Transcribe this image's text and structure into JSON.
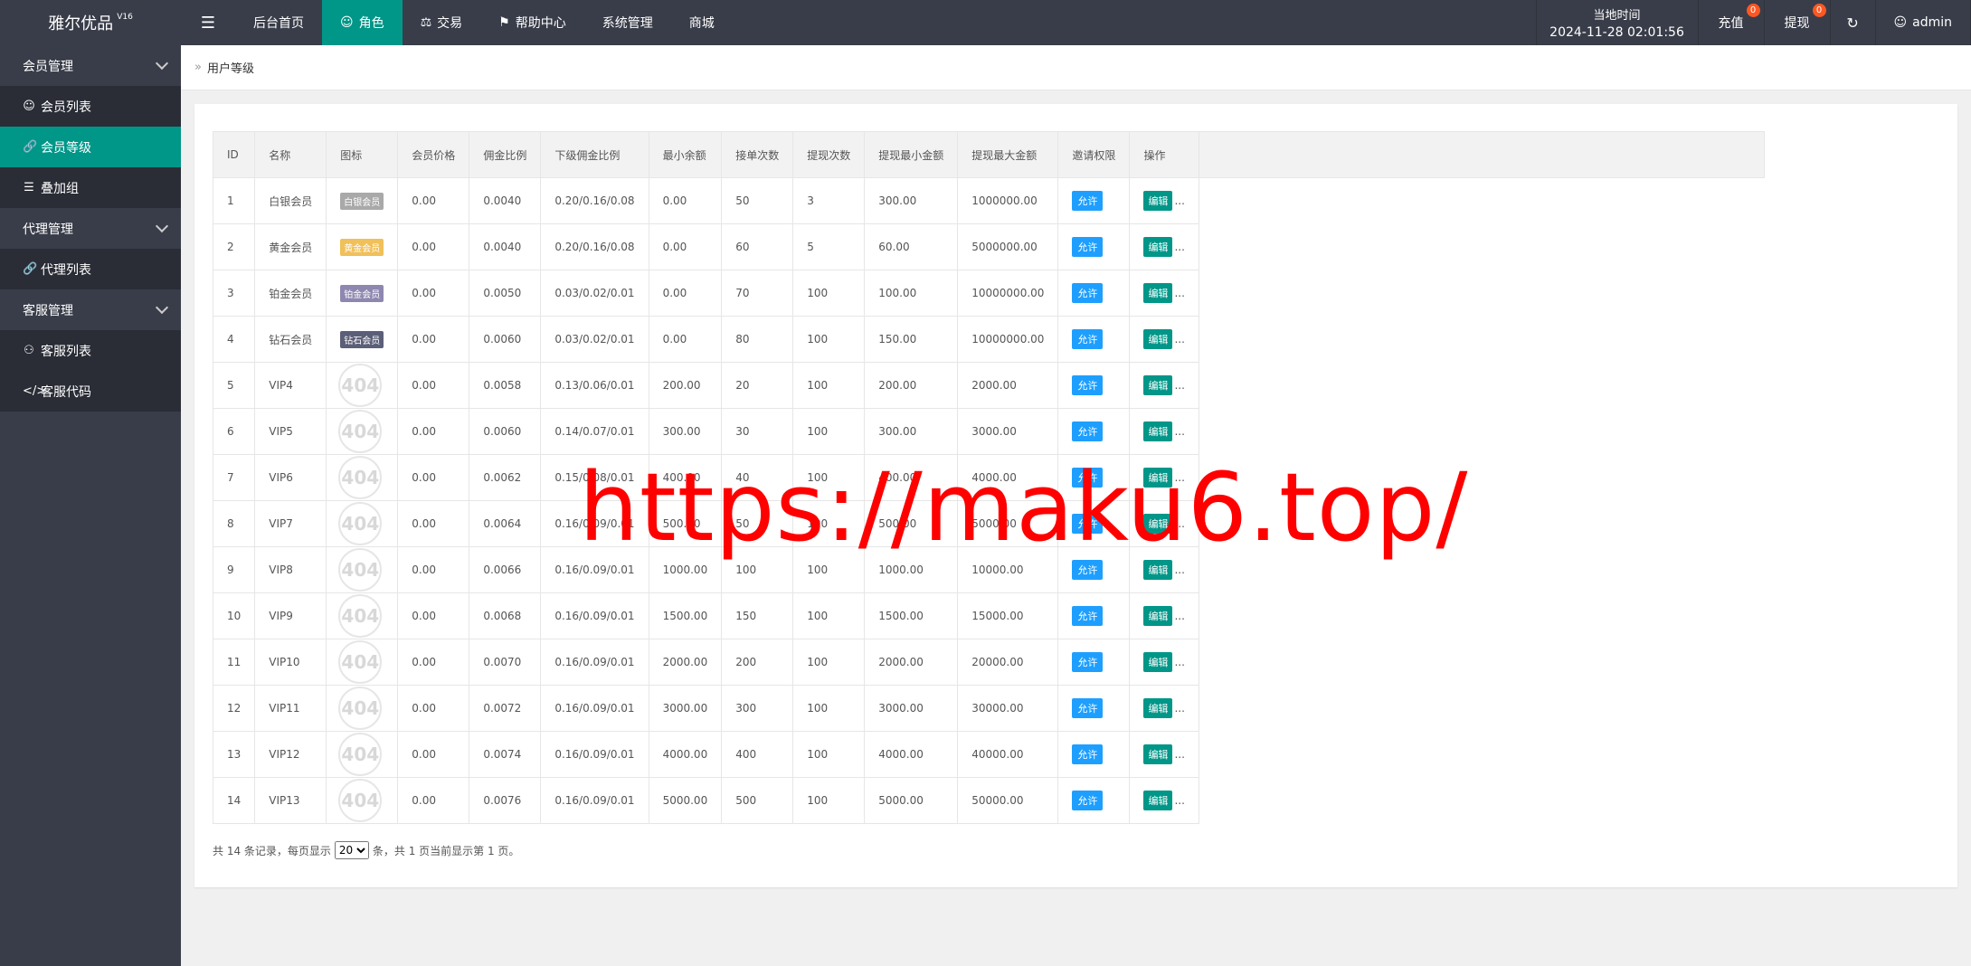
{
  "header": {
    "logo": "雅尔优品",
    "version": "V16",
    "nav": [
      {
        "label": "后台首页",
        "icon": "",
        "active": false
      },
      {
        "label": "角色",
        "icon": "user-icon",
        "active": true
      },
      {
        "label": "交易",
        "icon": "scale-icon",
        "active": false
      },
      {
        "label": "帮助中心",
        "icon": "flag-icon",
        "active": false
      },
      {
        "label": "系统管理",
        "icon": "",
        "active": false
      },
      {
        "label": "商城",
        "icon": "",
        "active": false
      }
    ],
    "time_label": "当地时间",
    "time_value": "2024-11-28 02:01:56",
    "recharge_label": "充值",
    "recharge_badge": "0",
    "withdraw_label": "提现",
    "withdraw_badge": "0",
    "user_name": "admin"
  },
  "sidebar": {
    "groups": [
      {
        "label": "会员管理",
        "items": [
          {
            "label": "会员列表",
            "icon": "user-icon",
            "active": false
          },
          {
            "label": "会员等级",
            "icon": "link-icon",
            "active": true
          },
          {
            "label": "叠加组",
            "icon": "list-icon",
            "active": false
          }
        ]
      },
      {
        "label": "代理管理",
        "items": [
          {
            "label": "代理列表",
            "icon": "link-icon",
            "active": false
          }
        ]
      },
      {
        "label": "客服管理",
        "items": [
          {
            "label": "客服列表",
            "icon": "users-icon",
            "active": false
          },
          {
            "label": "客服代码",
            "icon": "code-icon",
            "active": false
          }
        ]
      }
    ]
  },
  "breadcrumb": "用户等级",
  "table": {
    "headers": [
      "ID",
      "名称",
      "图标",
      "会员价格",
      "佣金比例",
      "下级佣金比例",
      "最小余额",
      "接单次数",
      "提现次数",
      "提现最小金额",
      "提现最大金额",
      "邀请权限",
      "操作"
    ],
    "allow_label": "允许",
    "edit_label": "编辑",
    "more_label": "...",
    "img_placeholder": "404",
    "rows": [
      {
        "id": "1",
        "name": "白银会员",
        "icon_text": "白银会员",
        "icon_color": "#a9a9a9",
        "price": "0.00",
        "rate": "0.0040",
        "sub_rate": "0.20/0.16/0.08",
        "min_balance": "0.00",
        "orders": "50",
        "withdraw_times": "3",
        "withdraw_min": "300.00",
        "withdraw_max": "1000000.00"
      },
      {
        "id": "2",
        "name": "黄金会员",
        "icon_text": "黄金会员",
        "icon_color": "#f0c05a",
        "price": "0.00",
        "rate": "0.0040",
        "sub_rate": "0.20/0.16/0.08",
        "min_balance": "0.00",
        "orders": "60",
        "withdraw_times": "5",
        "withdraw_min": "60.00",
        "withdraw_max": "5000000.00"
      },
      {
        "id": "3",
        "name": "铂金会员",
        "icon_text": "铂金会员",
        "icon_color": "#8e88b0",
        "price": "0.00",
        "rate": "0.0050",
        "sub_rate": "0.03/0.02/0.01",
        "min_balance": "0.00",
        "orders": "70",
        "withdraw_times": "100",
        "withdraw_min": "100.00",
        "withdraw_max": "10000000.00"
      },
      {
        "id": "4",
        "name": "钻石会员",
        "icon_text": "钻石会员",
        "icon_color": "#5c5f78",
        "price": "0.00",
        "rate": "0.0060",
        "sub_rate": "0.03/0.02/0.01",
        "min_balance": "0.00",
        "orders": "80",
        "withdraw_times": "100",
        "withdraw_min": "150.00",
        "withdraw_max": "10000000.00"
      },
      {
        "id": "5",
        "name": "VIP4",
        "icon_text": "",
        "icon_color": "",
        "price": "0.00",
        "rate": "0.0058",
        "sub_rate": "0.13/0.06/0.01",
        "min_balance": "200.00",
        "orders": "20",
        "withdraw_times": "100",
        "withdraw_min": "200.00",
        "withdraw_max": "2000.00"
      },
      {
        "id": "6",
        "name": "VIP5",
        "icon_text": "",
        "icon_color": "",
        "price": "0.00",
        "rate": "0.0060",
        "sub_rate": "0.14/0.07/0.01",
        "min_balance": "300.00",
        "orders": "30",
        "withdraw_times": "100",
        "withdraw_min": "300.00",
        "withdraw_max": "3000.00"
      },
      {
        "id": "7",
        "name": "VIP6",
        "icon_text": "",
        "icon_color": "",
        "price": "0.00",
        "rate": "0.0062",
        "sub_rate": "0.15/0.08/0.01",
        "min_balance": "400.00",
        "orders": "40",
        "withdraw_times": "100",
        "withdraw_min": "400.00",
        "withdraw_max": "4000.00"
      },
      {
        "id": "8",
        "name": "VIP7",
        "icon_text": "",
        "icon_color": "",
        "price": "0.00",
        "rate": "0.0064",
        "sub_rate": "0.16/0.09/0.01",
        "min_balance": "500.00",
        "orders": "50",
        "withdraw_times": "100",
        "withdraw_min": "500.00",
        "withdraw_max": "5000.00"
      },
      {
        "id": "9",
        "name": "VIP8",
        "icon_text": "",
        "icon_color": "",
        "price": "0.00",
        "rate": "0.0066",
        "sub_rate": "0.16/0.09/0.01",
        "min_balance": "1000.00",
        "orders": "100",
        "withdraw_times": "100",
        "withdraw_min": "1000.00",
        "withdraw_max": "10000.00"
      },
      {
        "id": "10",
        "name": "VIP9",
        "icon_text": "",
        "icon_color": "",
        "price": "0.00",
        "rate": "0.0068",
        "sub_rate": "0.16/0.09/0.01",
        "min_balance": "1500.00",
        "orders": "150",
        "withdraw_times": "100",
        "withdraw_min": "1500.00",
        "withdraw_max": "15000.00"
      },
      {
        "id": "11",
        "name": "VIP10",
        "icon_text": "",
        "icon_color": "",
        "price": "0.00",
        "rate": "0.0070",
        "sub_rate": "0.16/0.09/0.01",
        "min_balance": "2000.00",
        "orders": "200",
        "withdraw_times": "100",
        "withdraw_min": "2000.00",
        "withdraw_max": "20000.00"
      },
      {
        "id": "12",
        "name": "VIP11",
        "icon_text": "",
        "icon_color": "",
        "price": "0.00",
        "rate": "0.0072",
        "sub_rate": "0.16/0.09/0.01",
        "min_balance": "3000.00",
        "orders": "300",
        "withdraw_times": "100",
        "withdraw_min": "3000.00",
        "withdraw_max": "30000.00"
      },
      {
        "id": "13",
        "name": "VIP12",
        "icon_text": "",
        "icon_color": "",
        "price": "0.00",
        "rate": "0.0074",
        "sub_rate": "0.16/0.09/0.01",
        "min_balance": "4000.00",
        "orders": "400",
        "withdraw_times": "100",
        "withdraw_min": "4000.00",
        "withdraw_max": "40000.00"
      },
      {
        "id": "14",
        "name": "VIP13",
        "icon_text": "",
        "icon_color": "",
        "price": "0.00",
        "rate": "0.0076",
        "sub_rate": "0.16/0.09/0.01",
        "min_balance": "5000.00",
        "orders": "500",
        "withdraw_times": "100",
        "withdraw_min": "5000.00",
        "withdraw_max": "50000.00"
      }
    ]
  },
  "pager": {
    "prefix": "共 14 条记录，每页显示",
    "page_size": "20",
    "suffix": "条，共 1 页当前显示第 1 页。"
  },
  "watermark": "https://maku6.top/"
}
